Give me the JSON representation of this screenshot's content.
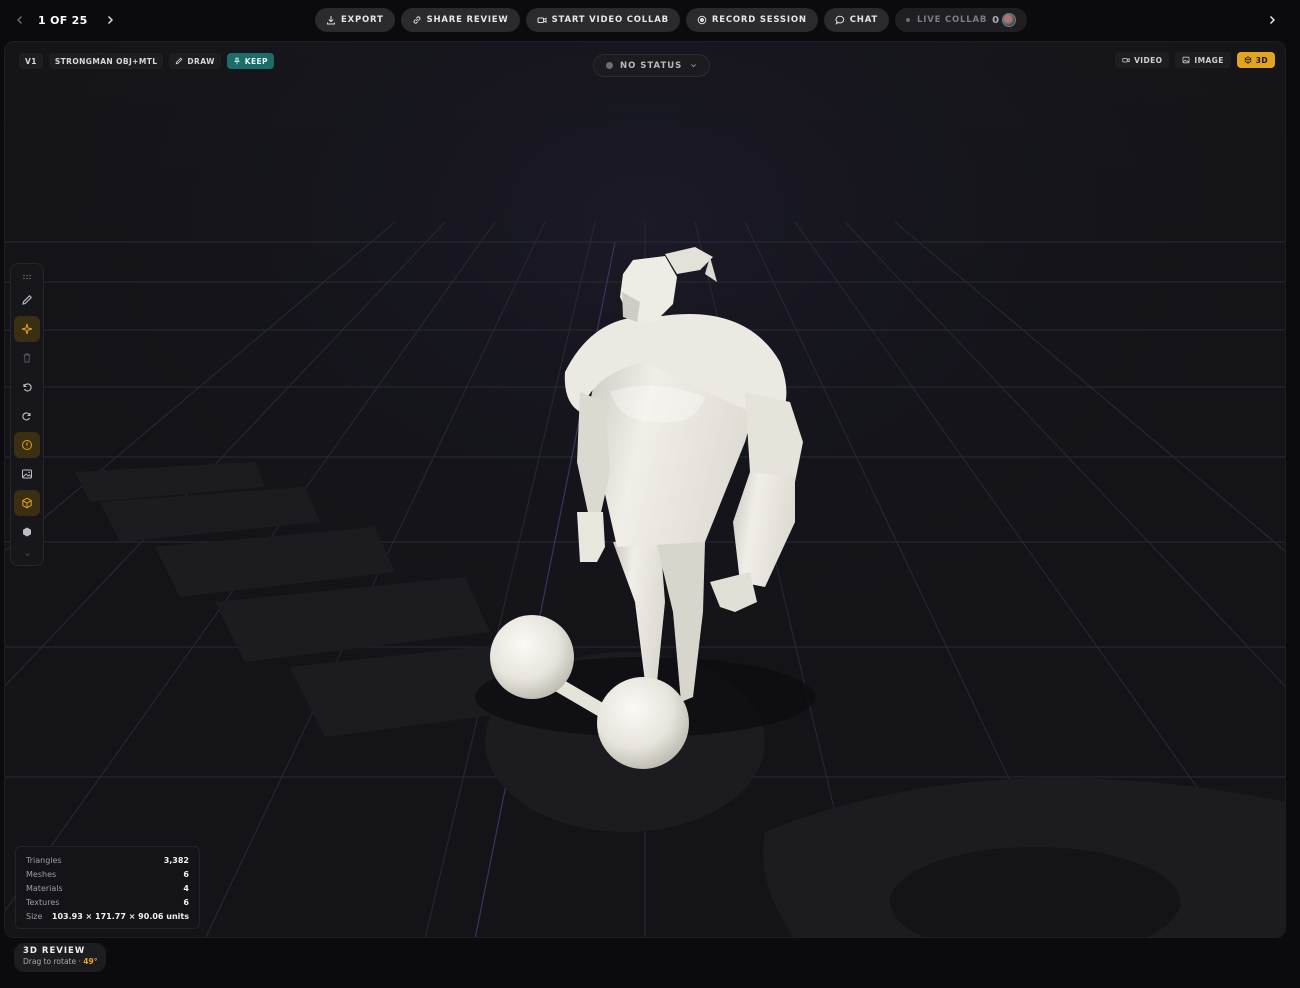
{
  "pager": {
    "text": "1 OF 25"
  },
  "actions": {
    "export": "EXPORT",
    "share_review": "SHARE REVIEW",
    "start_video_collab": "START VIDEO COLLAB",
    "record_session": "RECORD SESSION",
    "chat": "CHAT",
    "live_collab": "LIVE COLLAB",
    "live_count": "0"
  },
  "version_chips": {
    "version": "V1",
    "file": "STRONGMAN OBJ+MTL",
    "draw": "DRAW",
    "keep": "KEEP"
  },
  "status": {
    "label": "NO STATUS"
  },
  "modes": {
    "video": "VIDEO",
    "image": "IMAGE",
    "three_d": "3D",
    "active": "3D"
  },
  "stats": [
    {
      "label": "Triangles",
      "value": "3,382"
    },
    {
      "label": "Meshes",
      "value": "6"
    },
    {
      "label": "Materials",
      "value": "4"
    },
    {
      "label": "Textures",
      "value": "6"
    },
    {
      "label": "Size",
      "value": "103.93 × 171.77 × 90.06 units"
    }
  ],
  "review_badge": {
    "title": "3D REVIEW",
    "subtitle": "Drag to rotate · ",
    "angle": "49°"
  },
  "colors": {
    "accent": "#e0a420",
    "keep": "#1c6d6a",
    "model": "#e9e6de",
    "grid": "#2a2a33"
  },
  "icons": [
    "chevron-left-icon",
    "chevron-right-icon",
    "download-icon",
    "link-icon",
    "video-icon",
    "record-icon",
    "chat-icon",
    "pencil-icon",
    "pin-icon",
    "image-icon",
    "cube-icon"
  ]
}
